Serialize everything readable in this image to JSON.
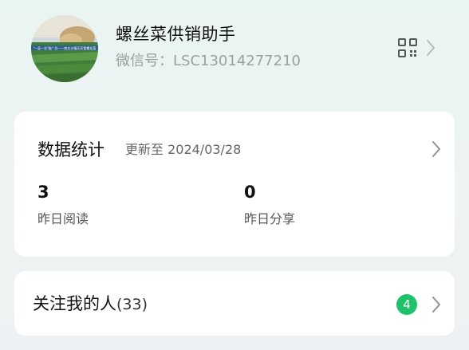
{
  "profile": {
    "name": "螺丝菜供销助手",
    "wechat_id": "微信号：LSC13014277210",
    "avatar_caption": "‘一县一业’推广员——南太水镇沃灵冒螺丝菜"
  },
  "stats": {
    "title": "数据统计",
    "updated": "更新至 2024/03/28",
    "metrics": [
      {
        "value": "3",
        "label": "昨日阅读"
      },
      {
        "value": "0",
        "label": "昨日分享"
      }
    ]
  },
  "followers": {
    "label": "关注我的人",
    "count": "(33)",
    "badge": "4"
  },
  "icons": {
    "qr": "qr-code-icon",
    "chevron": "chevron-right-icon"
  },
  "colors": {
    "badge": "#1fc16b",
    "background": "#eaf3f1",
    "card": "#ffffff"
  }
}
